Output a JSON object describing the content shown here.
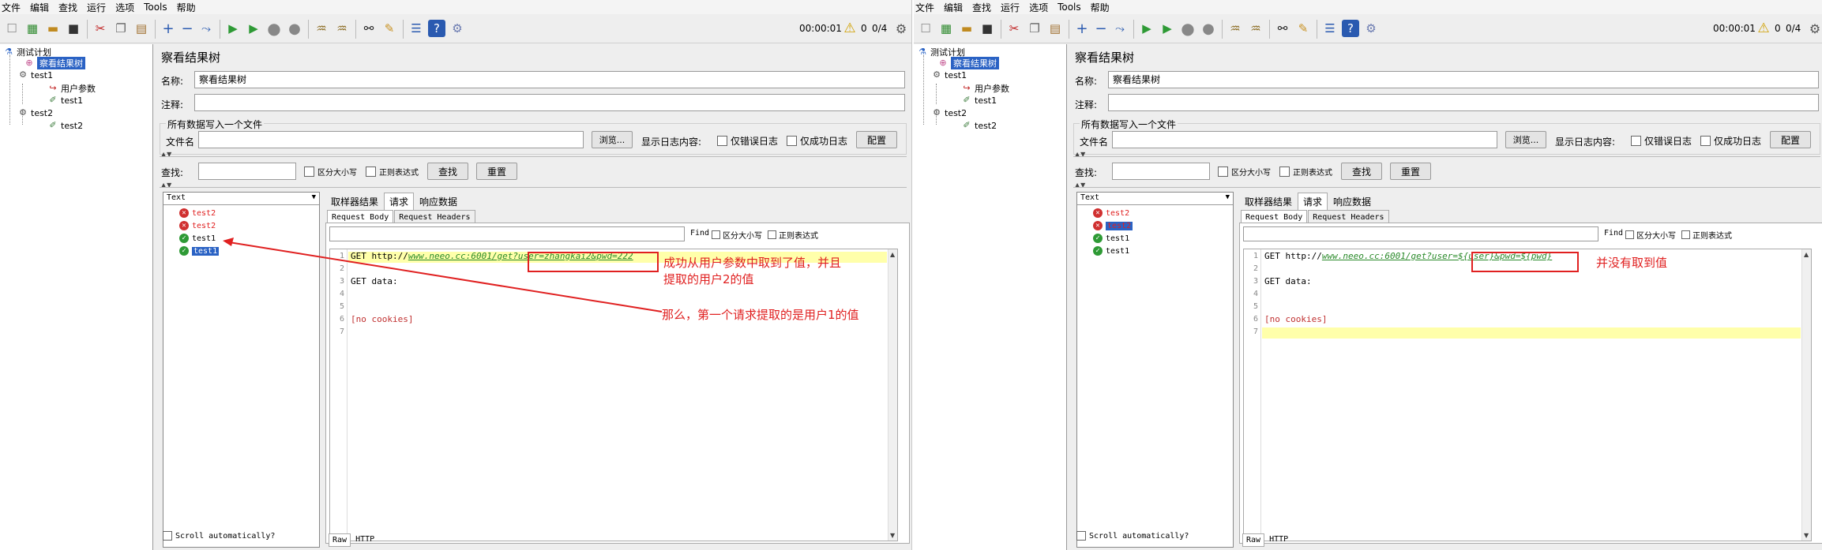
{
  "menu": [
    "文件",
    "编辑",
    "查找",
    "运行",
    "选项",
    "Tools",
    "帮助"
  ],
  "toolbar": {
    "timer": "00:00:01",
    "warn_count": "0",
    "threads": "0/4"
  },
  "tree": {
    "plan": "测试计划",
    "listener": "察看结果树",
    "tg1": "test1",
    "user_params": "用户参数",
    "sampler1": "test1",
    "tg2": "test2",
    "sampler2": "test2"
  },
  "panel": {
    "title": "察看结果树",
    "name_label": "名称:",
    "name_value": "察看结果树",
    "comment_label": "注释:",
    "file_group": "所有数据写入一个文件",
    "filename_label": "文件名",
    "browse": "浏览...",
    "log_label": "显示日志内容:",
    "only_errors": "仅错误日志",
    "only_success": "仅成功日志",
    "configure": "配置",
    "search_label": "查找:",
    "case": "区分大小写",
    "regex": "正则表达式",
    "search_btn": "查找",
    "reset_btn": "重置",
    "renderer": "Text",
    "tab_sampler": "取样器结果",
    "tab_request": "请求",
    "tab_response": "响应数据",
    "sub_body": "Request Body",
    "sub_headers": "Request Headers",
    "find_label": "Find",
    "find_case": "区分大小写",
    "find_regex": "正则表达式",
    "scroll_auto": "Scroll automatically?",
    "raw": "Raw",
    "http": "HTTP"
  },
  "left": {
    "results": [
      "test2",
      "test2",
      "test1",
      "test1"
    ],
    "line_numbers": [
      "1",
      "2",
      "3",
      "4",
      "5",
      "6",
      "7"
    ],
    "line1_pre": "GET http://",
    "line1_url": "www.neeo.cc:6001/get?user=zhangkai2&pwd=222",
    "line3": "GET data:",
    "line6": "[no cookies]",
    "anno1a": "成功从用户参数中取到了值，并且",
    "anno1b": "提取的用户2的值",
    "anno2": "那么，第一个请求提取的是用户1的值"
  },
  "right": {
    "results": [
      "test2",
      "test2",
      "test1",
      "test1"
    ],
    "line_numbers": [
      "1",
      "2",
      "3",
      "4",
      "5",
      "6",
      "7"
    ],
    "line1_pre": "GET http://",
    "line1_url": "www.neeo.cc:6001/get?user=${user}&pwd=${pwd}",
    "line3": "GET data:",
    "line6": "[no cookies]",
    "anno1": "并没有取到值"
  }
}
